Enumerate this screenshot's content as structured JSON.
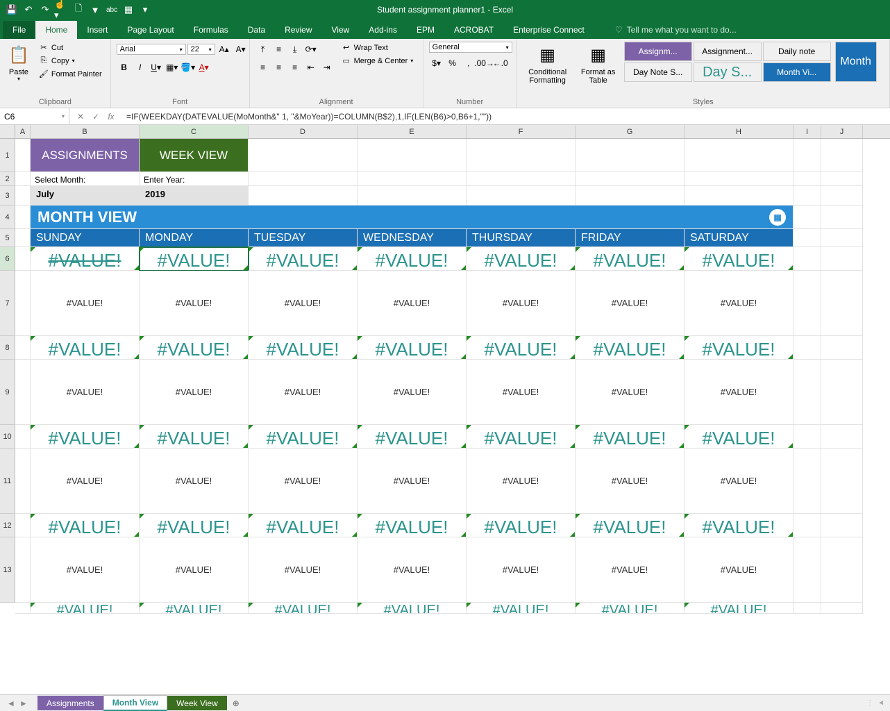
{
  "title": "Student assignment planner1 - Excel",
  "tabs": [
    "File",
    "Home",
    "Insert",
    "Page Layout",
    "Formulas",
    "Data",
    "Review",
    "View",
    "Add-ins",
    "EPM",
    "ACROBAT",
    "Enterprise Connect"
  ],
  "activeTab": "Home",
  "tellMe": "Tell me what you want to do...",
  "clipboard": {
    "paste": "Paste",
    "cut": "Cut",
    "copy": "Copy",
    "formatPainter": "Format Painter",
    "label": "Clipboard"
  },
  "font": {
    "name": "Arial",
    "size": "22",
    "label": "Font"
  },
  "alignment": {
    "wrapText": "Wrap Text",
    "mergeCenter": "Merge & Center",
    "label": "Alignment"
  },
  "number": {
    "format": "General",
    "label": "Number"
  },
  "styles": {
    "cond": "Conditional Formatting",
    "formatAs": "Format as Table",
    "label": "Styles",
    "cells": [
      {
        "t": "Assignm...",
        "bg": "#7d62a8",
        "fg": "#fff"
      },
      {
        "t": "Assignment...",
        "bg": "#fff",
        "fg": "#333"
      },
      {
        "t": "Daily note",
        "bg": "#fff",
        "fg": "#333"
      },
      {
        "t": "Day Note S...",
        "bg": "#fff",
        "fg": "#333",
        "small": true
      },
      {
        "t": "Day S...",
        "bg": "#fff",
        "fg": "#2c948e",
        "big": true
      },
      {
        "t": "Month Vi...",
        "bg": "#1b6fb5",
        "fg": "#fff"
      }
    ],
    "month": "Month"
  },
  "nameBox": "C6",
  "formula": "=IF(WEEKDAY(DATEVALUE(MoMonth&\" 1, \"&MoYear))=COLUMN(B$2),1,IF(LEN(B6)>0,B6+1,\"\"))",
  "cols": [
    "A",
    "B",
    "C",
    "D",
    "E",
    "F",
    "G",
    "H",
    "I",
    "J"
  ],
  "rowNums": [
    1,
    2,
    3,
    4,
    5,
    6,
    7,
    8,
    9,
    10,
    11,
    12,
    13
  ],
  "sheet": {
    "assignments": "ASSIGNMENTS",
    "weekView": "WEEK VIEW",
    "selectMonth": "Select Month:",
    "enterYear": "Enter Year:",
    "month": "July",
    "year": "2019",
    "monthView": "MONTH VIEW",
    "days": [
      "SUNDAY",
      "MONDAY",
      "TUESDAY",
      "WEDNESDAY",
      "THURSDAY",
      "FRIDAY",
      "SATURDAY"
    ],
    "err": "#VALUE!"
  },
  "sheetTabs": {
    "assignments": "Assignments",
    "monthView": "Month View",
    "weekView": "Week View"
  }
}
